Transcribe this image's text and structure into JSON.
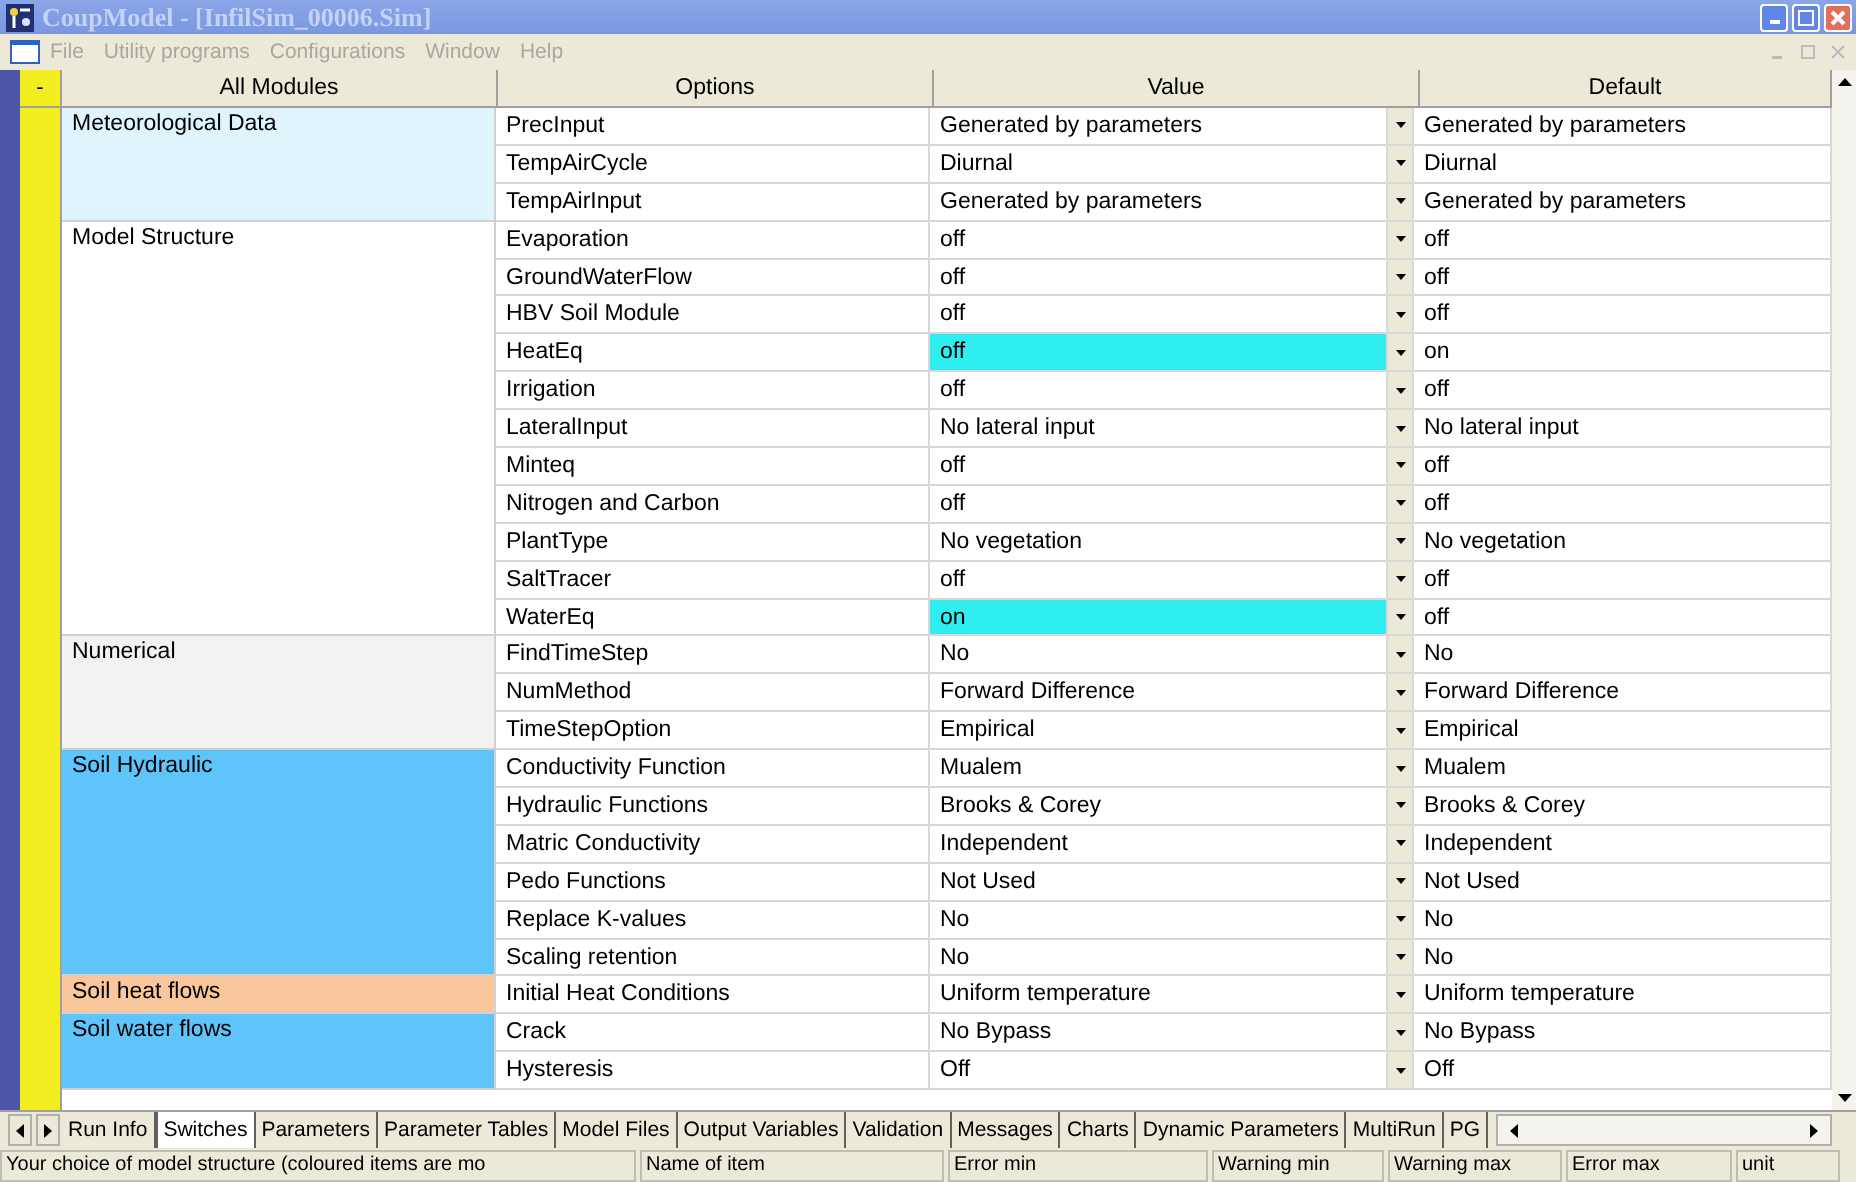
{
  "window": {
    "title": "CoupModel - [InfilSim_00006.Sim]"
  },
  "menu": [
    "File",
    "Utility programs",
    "Configurations",
    "Window",
    "Help"
  ],
  "table": {
    "corner": "-",
    "columns": [
      "All Modules",
      "Options",
      "Value",
      "Default"
    ],
    "groups": [
      {
        "module": "Meteorological Data",
        "color": "#dff4fc",
        "rows": [
          {
            "option": "PrecInput",
            "value": "Generated by parameters",
            "default": "Generated by parameters",
            "highlighted": false
          },
          {
            "option": "TempAirCycle",
            "value": "Diurnal",
            "default": "Diurnal",
            "highlighted": false
          },
          {
            "option": "TempAirInput",
            "value": "Generated by parameters",
            "default": "Generated by parameters",
            "highlighted": false
          }
        ]
      },
      {
        "module": "Model Structure",
        "color": "#ffffff",
        "rows": [
          {
            "option": "Evaporation",
            "value": "off",
            "default": "off",
            "highlighted": false
          },
          {
            "option": "GroundWaterFlow",
            "value": "off",
            "default": "off",
            "highlighted": false
          },
          {
            "option": "HBV Soil Module",
            "value": "off",
            "default": "off",
            "highlighted": false
          },
          {
            "option": "HeatEq",
            "value": "off",
            "default": "on",
            "highlighted": true
          },
          {
            "option": "Irrigation",
            "value": "off",
            "default": "off",
            "highlighted": false
          },
          {
            "option": "LateralInput",
            "value": "No lateral input",
            "default": "No lateral input",
            "highlighted": false
          },
          {
            "option": "Minteq",
            "value": "off",
            "default": "off",
            "highlighted": false
          },
          {
            "option": "Nitrogen and Carbon",
            "value": "off",
            "default": "off",
            "highlighted": false
          },
          {
            "option": "PlantType",
            "value": "No vegetation",
            "default": "No vegetation",
            "highlighted": false
          },
          {
            "option": "SaltTracer",
            "value": "off",
            "default": "off",
            "highlighted": false
          },
          {
            "option": "WaterEq",
            "value": "on",
            "default": "off",
            "highlighted": true
          }
        ]
      },
      {
        "module": "Numerical",
        "color": "#f2f2f2",
        "rows": [
          {
            "option": "FindTimeStep",
            "value": "No",
            "default": "No",
            "highlighted": false
          },
          {
            "option": "NumMethod",
            "value": "Forward Difference",
            "default": "Forward Difference",
            "highlighted": false
          },
          {
            "option": "TimeStepOption",
            "value": "Empirical",
            "default": "Empirical",
            "highlighted": false
          }
        ]
      },
      {
        "module": "Soil Hydraulic",
        "color": "#5ec4fa",
        "rows": [
          {
            "option": "Conductivity Function",
            "value": "Mualem",
            "default": "Mualem",
            "highlighted": false
          },
          {
            "option": "Hydraulic Functions",
            "value": "Brooks & Corey",
            "default": "Brooks & Corey",
            "highlighted": false
          },
          {
            "option": "Matric Conductivity",
            "value": "Independent",
            "default": "Independent",
            "highlighted": false
          },
          {
            "option": "Pedo Functions",
            "value": "Not Used",
            "default": "Not Used",
            "highlighted": false
          },
          {
            "option": "Replace K-values",
            "value": "No",
            "default": "No",
            "highlighted": false
          },
          {
            "option": "Scaling retention",
            "value": "No",
            "default": "No",
            "highlighted": false
          }
        ]
      },
      {
        "module": "Soil heat flows",
        "color": "#f9c79b",
        "rows": [
          {
            "option": "Initial Heat Conditions",
            "value": "Uniform temperature",
            "default": "Uniform temperature",
            "highlighted": false
          }
        ]
      },
      {
        "module": "Soil water flows",
        "color": "#5ec4fa",
        "rows": [
          {
            "option": "Crack",
            "value": "No Bypass",
            "default": "No Bypass",
            "highlighted": false
          },
          {
            "option": "Hysteresis",
            "value": "Off",
            "default": "Off",
            "highlighted": false
          }
        ]
      }
    ]
  },
  "tabs": [
    {
      "label": "Run Info",
      "selected": false
    },
    {
      "label": "Switches",
      "selected": true
    },
    {
      "label": "Parameters",
      "selected": false
    },
    {
      "label": "Parameter Tables",
      "selected": false
    },
    {
      "label": "Model Files",
      "selected": false
    },
    {
      "label": "Output Variables",
      "selected": false
    },
    {
      "label": "Validation",
      "selected": false
    },
    {
      "label": "Messages",
      "selected": false
    },
    {
      "label": "Charts",
      "selected": false
    },
    {
      "label": "Dynamic Parameters",
      "selected": false
    },
    {
      "label": "MultiRun",
      "selected": false
    },
    {
      "label": "PG",
      "selected": false
    }
  ],
  "status_bar": [
    "Your choice of model structure (coloured items are mo",
    "Name of item",
    "Error min",
    "Warning min",
    "Warning max",
    "Error max",
    "unit"
  ]
}
